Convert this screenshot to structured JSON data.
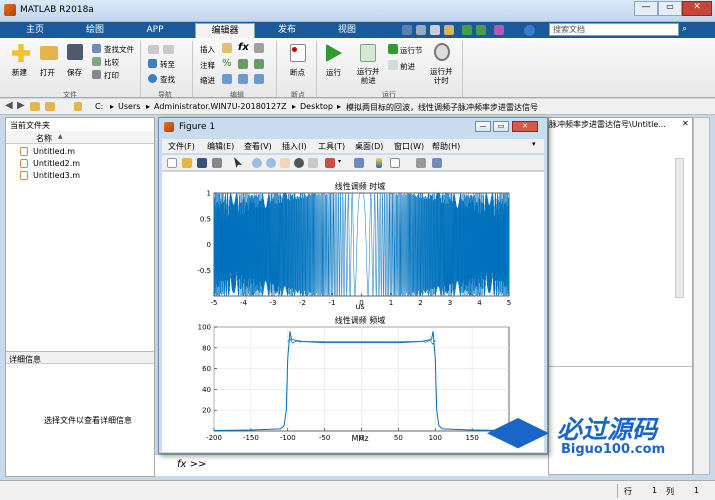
{
  "app": {
    "title": "MATLAB R2018a",
    "search_placeholder": "搜索文档"
  },
  "tabs": [
    "主页",
    "绘图",
    "APP",
    "编辑器",
    "发布",
    "视图"
  ],
  "ribbon": {
    "new": "新建",
    "open": "打开",
    "save": "保存",
    "find_files": "查找文件",
    "compare": "比较",
    "print": "打印",
    "group_file": "文件",
    "goto": "转至",
    "find": "查找",
    "group_nav": "导航",
    "insert": "插入",
    "comment": "注释",
    "indent": "缩进",
    "fx": "fx",
    "group_edit": "编辑",
    "breakpoints": "断点",
    "group_breakpoints": "断点",
    "run": "运行",
    "run_advance": "运行并\n前进",
    "run_section": "运行节",
    "advance": "前进",
    "run_time": "运行并\n计时",
    "group_run": "运行"
  },
  "address": {
    "path": [
      "C:",
      "Users",
      "Administrator.WIN7U-20180127Z",
      "Desktop",
      "模拟两目标的回波，线性调频子脉冲频率步进雷达信号"
    ]
  },
  "current_folder": {
    "title": "当前文件夹",
    "col_name": "名称",
    "sort": "▲",
    "files": [
      "Untitled.m",
      "Untitled2.m",
      "Untitled3.m"
    ]
  },
  "details": {
    "title": "详细信息",
    "hint": "选择文件以查看详细信息"
  },
  "editor_tab_title": "脉冲频率步进雷达信号\\Untitle...",
  "command": {
    "prompt": "fx >>"
  },
  "status": {
    "row_label": "行",
    "row": "1",
    "col_label": "列",
    "col": "1"
  },
  "figure": {
    "title": "Figure 1",
    "menu": [
      "文件(F)",
      "编辑(E)",
      "查看(V)",
      "插入(I)",
      "工具(T)",
      "桌面(D)",
      "窗口(W)",
      "帮助(H)"
    ]
  },
  "watermark": {
    "text": "必过源码",
    "url": "Biguo100.com"
  },
  "chart_data": [
    {
      "type": "line",
      "title": "线性调频 时域",
      "xlabel": "us",
      "ylabel": "",
      "xlim": [
        -5,
        5
      ],
      "ylim": [
        -1,
        1
      ],
      "xticks": [
        -5,
        -4,
        -3,
        -2,
        -1,
        0,
        1,
        2,
        3,
        4,
        5
      ],
      "yticks": [
        -0.5,
        0,
        0.5,
        1
      ],
      "series": [
        {
          "description": "real part of LFM chirp, cos(pi*k*t^2), dense oscillation",
          "amplitude": 1,
          "x_range": [
            -5,
            5
          ]
        }
      ],
      "color": "#0072bd",
      "grid": false
    },
    {
      "type": "line",
      "title": "线性调频 频域",
      "xlabel": "MHz",
      "ylabel": "",
      "xlim": [
        -200,
        200
      ],
      "ylim": [
        0,
        100
      ],
      "xticks": [
        -200,
        -150,
        -100,
        -50,
        0,
        50,
        100,
        150
      ],
      "yticks": [
        20,
        40,
        60,
        80,
        100
      ],
      "series": [
        {
          "x": [
            -200,
            -150,
            -110,
            -105,
            -102,
            -100,
            -97,
            -95,
            -80,
            -50,
            0,
            50,
            80,
            95,
            97,
            100,
            102,
            105,
            110,
            150,
            200
          ],
          "y": [
            0.5,
            1,
            2,
            5,
            20,
            70,
            96,
            88,
            86,
            85,
            85,
            85,
            86,
            88,
            96,
            70,
            20,
            5,
            2,
            1,
            0.5
          ]
        }
      ],
      "color": "#0072bd",
      "grid": true
    }
  ]
}
